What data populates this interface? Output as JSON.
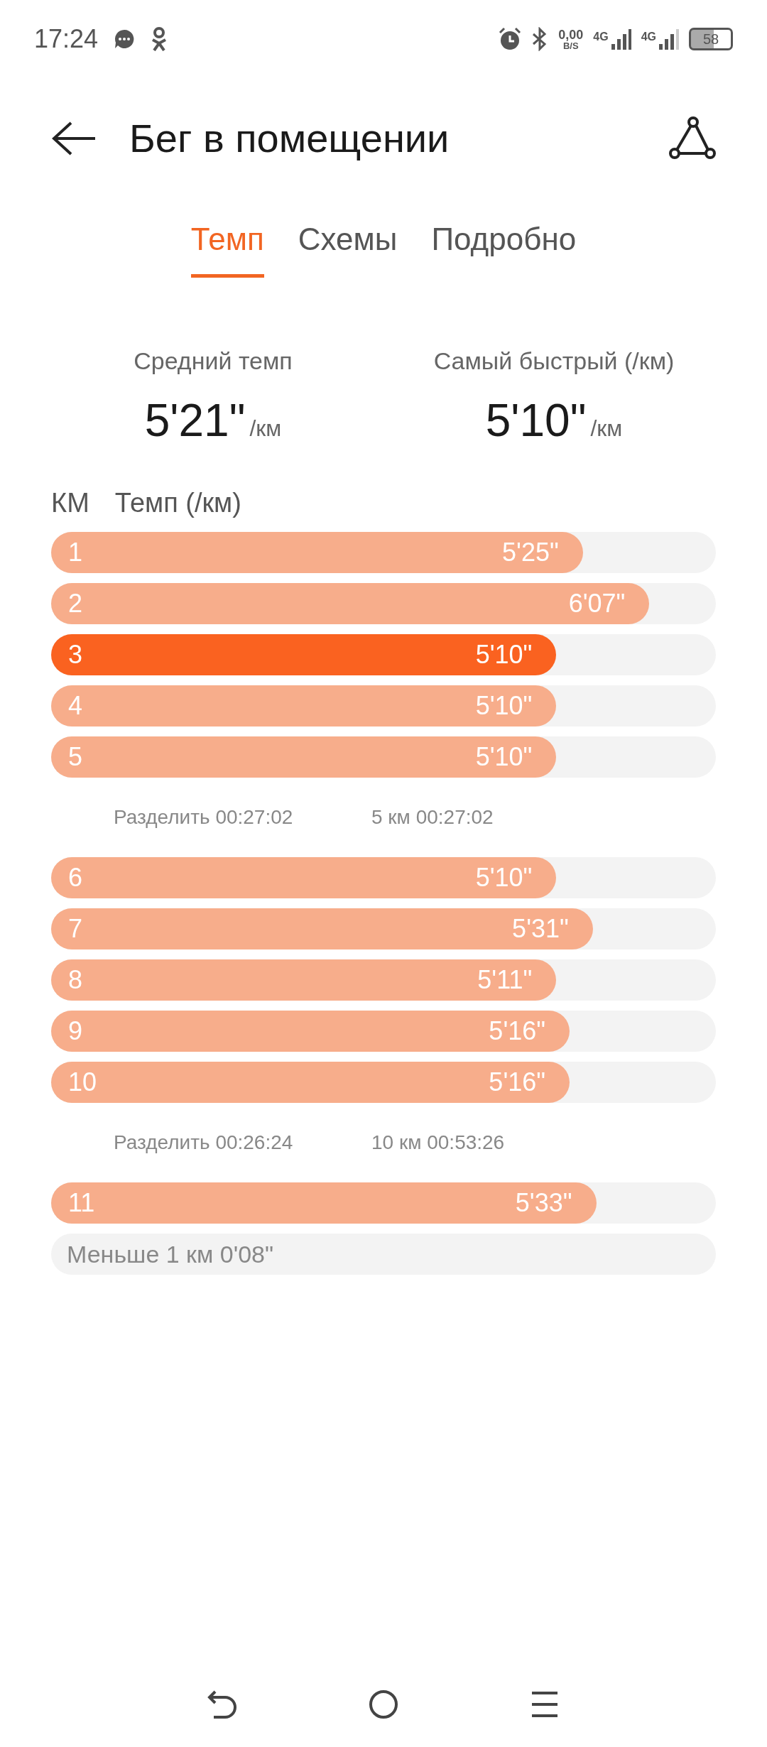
{
  "status_bar": {
    "time": "17:24",
    "net_speed": "0,00",
    "net_unit": "B/S",
    "sim1": "4G",
    "sim2": "4G",
    "battery": "58"
  },
  "header": {
    "title": "Бег в помещении"
  },
  "tabs": [
    {
      "label": "Темп",
      "selected": true
    },
    {
      "label": "Схемы",
      "selected": false
    },
    {
      "label": "Подробно",
      "selected": false
    }
  ],
  "summary": [
    {
      "label": "Средний темп",
      "value": "5'21\"",
      "unit": "/км"
    },
    {
      "label": "Самый быстрый (/км)",
      "value": "5'10\"",
      "unit": "/км"
    }
  ],
  "table": {
    "columns": [
      "КМ",
      "Темп (/км)"
    ],
    "rows": [
      {
        "kind": "lap",
        "km": "1",
        "pace": "5'25\"",
        "level": 0.8,
        "selected": false
      },
      {
        "kind": "lap",
        "km": "2",
        "pace": "6'07\"",
        "level": 0.9,
        "selected": false
      },
      {
        "kind": "lap",
        "km": "3",
        "pace": "5'10\"",
        "level": 0.76,
        "selected": true
      },
      {
        "kind": "lap",
        "km": "4",
        "pace": "5'10\"",
        "level": 0.76,
        "selected": false
      },
      {
        "kind": "lap",
        "km": "5",
        "pace": "5'10\"",
        "level": 0.76,
        "selected": false
      },
      {
        "kind": "split",
        "split": "Разделить 00:27:02",
        "total": "5 км 00:27:02"
      },
      {
        "kind": "lap",
        "km": "6",
        "pace": "5'10\"",
        "level": 0.76,
        "selected": false
      },
      {
        "kind": "lap",
        "km": "7",
        "pace": "5'31\"",
        "level": 0.815,
        "selected": false
      },
      {
        "kind": "lap",
        "km": "8",
        "pace": "5'11\"",
        "level": 0.76,
        "selected": false
      },
      {
        "kind": "lap",
        "km": "9",
        "pace": "5'16\"",
        "level": 0.78,
        "selected": false
      },
      {
        "kind": "lap",
        "km": "10",
        "pace": "5'16\"",
        "level": 0.78,
        "selected": false
      },
      {
        "kind": "split",
        "split": "Разделить 00:26:24",
        "total": "10 км 00:53:26"
      },
      {
        "kind": "lap",
        "km": "11",
        "pace": "5'33\"",
        "level": 0.82,
        "selected": false
      },
      {
        "kind": "remainder",
        "text": "Меньше 1 км 0'08\""
      }
    ]
  }
}
